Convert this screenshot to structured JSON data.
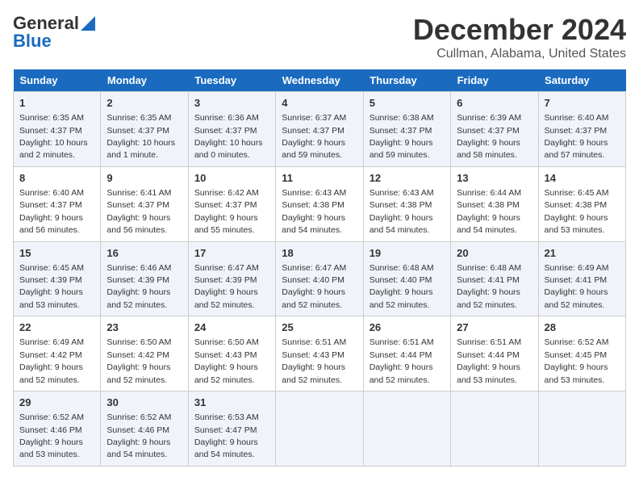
{
  "logo": {
    "line1": "General",
    "line2": "Blue"
  },
  "title": "December 2024",
  "subtitle": "Cullman, Alabama, United States",
  "days_of_week": [
    "Sunday",
    "Monday",
    "Tuesday",
    "Wednesday",
    "Thursday",
    "Friday",
    "Saturday"
  ],
  "weeks": [
    [
      {
        "num": "1",
        "sunrise": "6:35 AM",
        "sunset": "4:37 PM",
        "daylight": "10 hours and 2 minutes."
      },
      {
        "num": "2",
        "sunrise": "6:35 AM",
        "sunset": "4:37 PM",
        "daylight": "10 hours and 1 minute."
      },
      {
        "num": "3",
        "sunrise": "6:36 AM",
        "sunset": "4:37 PM",
        "daylight": "10 hours and 0 minutes."
      },
      {
        "num": "4",
        "sunrise": "6:37 AM",
        "sunset": "4:37 PM",
        "daylight": "9 hours and 59 minutes."
      },
      {
        "num": "5",
        "sunrise": "6:38 AM",
        "sunset": "4:37 PM",
        "daylight": "9 hours and 59 minutes."
      },
      {
        "num": "6",
        "sunrise": "6:39 AM",
        "sunset": "4:37 PM",
        "daylight": "9 hours and 58 minutes."
      },
      {
        "num": "7",
        "sunrise": "6:40 AM",
        "sunset": "4:37 PM",
        "daylight": "9 hours and 57 minutes."
      }
    ],
    [
      {
        "num": "8",
        "sunrise": "6:40 AM",
        "sunset": "4:37 PM",
        "daylight": "9 hours and 56 minutes."
      },
      {
        "num": "9",
        "sunrise": "6:41 AM",
        "sunset": "4:37 PM",
        "daylight": "9 hours and 56 minutes."
      },
      {
        "num": "10",
        "sunrise": "6:42 AM",
        "sunset": "4:37 PM",
        "daylight": "9 hours and 55 minutes."
      },
      {
        "num": "11",
        "sunrise": "6:43 AM",
        "sunset": "4:38 PM",
        "daylight": "9 hours and 54 minutes."
      },
      {
        "num": "12",
        "sunrise": "6:43 AM",
        "sunset": "4:38 PM",
        "daylight": "9 hours and 54 minutes."
      },
      {
        "num": "13",
        "sunrise": "6:44 AM",
        "sunset": "4:38 PM",
        "daylight": "9 hours and 54 minutes."
      },
      {
        "num": "14",
        "sunrise": "6:45 AM",
        "sunset": "4:38 PM",
        "daylight": "9 hours and 53 minutes."
      }
    ],
    [
      {
        "num": "15",
        "sunrise": "6:45 AM",
        "sunset": "4:39 PM",
        "daylight": "9 hours and 53 minutes."
      },
      {
        "num": "16",
        "sunrise": "6:46 AM",
        "sunset": "4:39 PM",
        "daylight": "9 hours and 52 minutes."
      },
      {
        "num": "17",
        "sunrise": "6:47 AM",
        "sunset": "4:39 PM",
        "daylight": "9 hours and 52 minutes."
      },
      {
        "num": "18",
        "sunrise": "6:47 AM",
        "sunset": "4:40 PM",
        "daylight": "9 hours and 52 minutes."
      },
      {
        "num": "19",
        "sunrise": "6:48 AM",
        "sunset": "4:40 PM",
        "daylight": "9 hours and 52 minutes."
      },
      {
        "num": "20",
        "sunrise": "6:48 AM",
        "sunset": "4:41 PM",
        "daylight": "9 hours and 52 minutes."
      },
      {
        "num": "21",
        "sunrise": "6:49 AM",
        "sunset": "4:41 PM",
        "daylight": "9 hours and 52 minutes."
      }
    ],
    [
      {
        "num": "22",
        "sunrise": "6:49 AM",
        "sunset": "4:42 PM",
        "daylight": "9 hours and 52 minutes."
      },
      {
        "num": "23",
        "sunrise": "6:50 AM",
        "sunset": "4:42 PM",
        "daylight": "9 hours and 52 minutes."
      },
      {
        "num": "24",
        "sunrise": "6:50 AM",
        "sunset": "4:43 PM",
        "daylight": "9 hours and 52 minutes."
      },
      {
        "num": "25",
        "sunrise": "6:51 AM",
        "sunset": "4:43 PM",
        "daylight": "9 hours and 52 minutes."
      },
      {
        "num": "26",
        "sunrise": "6:51 AM",
        "sunset": "4:44 PM",
        "daylight": "9 hours and 52 minutes."
      },
      {
        "num": "27",
        "sunrise": "6:51 AM",
        "sunset": "4:44 PM",
        "daylight": "9 hours and 53 minutes."
      },
      {
        "num": "28",
        "sunrise": "6:52 AM",
        "sunset": "4:45 PM",
        "daylight": "9 hours and 53 minutes."
      }
    ],
    [
      {
        "num": "29",
        "sunrise": "6:52 AM",
        "sunset": "4:46 PM",
        "daylight": "9 hours and 53 minutes."
      },
      {
        "num": "30",
        "sunrise": "6:52 AM",
        "sunset": "4:46 PM",
        "daylight": "9 hours and 54 minutes."
      },
      {
        "num": "31",
        "sunrise": "6:53 AM",
        "sunset": "4:47 PM",
        "daylight": "9 hours and 54 minutes."
      },
      null,
      null,
      null,
      null
    ]
  ]
}
